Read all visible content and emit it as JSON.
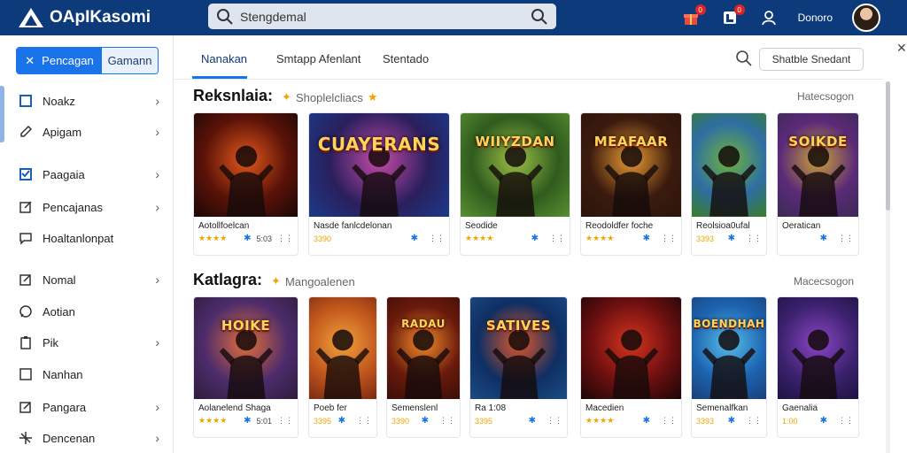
{
  "brand": {
    "name": "OApIKasomi"
  },
  "search": {
    "value": "Stengdemal"
  },
  "topbar": {
    "user_label": "Donoro",
    "badge_a": "0",
    "badge_b": "0"
  },
  "sidebar": {
    "toggle_primary": "Pencagan",
    "toggle_secondary": "Gamann",
    "items": [
      {
        "label": "Noakz",
        "icon": "square-icon"
      },
      {
        "label": "Apigam",
        "icon": "pencil-icon"
      },
      {
        "label": "Paagaia",
        "icon": "checkbox-icon"
      },
      {
        "label": "Pencajanas",
        "icon": "edit-icon"
      },
      {
        "label": "Hoaltanlonpat",
        "icon": "chat-icon"
      },
      {
        "label": "Nomal",
        "icon": "pencil-icon"
      },
      {
        "label": "Aotian",
        "icon": "message-icon"
      },
      {
        "label": "Pik",
        "icon": "clipboard-icon"
      },
      {
        "label": "Nanhan",
        "icon": "square-icon"
      },
      {
        "label": "Pangara",
        "icon": "edit-icon"
      },
      {
        "label": "Dencenan",
        "icon": "star-icon"
      }
    ]
  },
  "tabs": [
    {
      "label": "Nanakan"
    },
    {
      "label": "Smtapp Afenlant"
    },
    {
      "label": "Stentado"
    }
  ],
  "toolbar": {
    "button_label": "Shatble Snedant"
  },
  "section1": {
    "title": "Reksnlaia:",
    "subtitle": "Shoplelcliacs",
    "more": "Hatecsogon",
    "cards": [
      {
        "title_art": "",
        "name": "Aotollfoelcan",
        "stars": "★★★★",
        "price": "5:03",
        "colors": [
          "#5a1208",
          "#e2571b",
          "#1a0806"
        ]
      },
      {
        "title_art": "CUAYERANS",
        "name": "Nasde fanlcdelonan",
        "stars": "3390",
        "price": "",
        "colors": [
          "#2a1f5c",
          "#c64ba8",
          "#1b3a8a"
        ]
      },
      {
        "title_art": "WIIYZDAN",
        "name": "Seodide",
        "stars": "★★★★",
        "price": "",
        "colors": [
          "#2f5b1e",
          "#9bbf45",
          "#5a8f31"
        ]
      },
      {
        "title_art": "MEAFAAR",
        "name": "Reodoldfer foche",
        "stars": "★★★★",
        "price": "",
        "colors": [
          "#3c1b0e",
          "#e89a33",
          "#2b140b"
        ]
      },
      {
        "title_art": "",
        "name": "Reolsioa0ufal",
        "stars": "3393",
        "price": "",
        "colors": [
          "#2e6ea3",
          "#6fb23c",
          "#3b7d2a"
        ]
      },
      {
        "title_art": "SOIKDE",
        "name": "Oeratican",
        "stars": "",
        "price": "",
        "colors": [
          "#5b2a78",
          "#c9a13a",
          "#3a2a55"
        ]
      }
    ]
  },
  "section2": {
    "title": "Katlagra:",
    "subtitle": "Mangoalenen",
    "more": "Macecsogon",
    "cards": [
      {
        "title_art": "HOIKE",
        "name": "Aolanelend Shaga",
        "stars": "★★★★",
        "price": "5:01",
        "colors": [
          "#4d2c6b",
          "#e36d3a",
          "#2d1d3d"
        ]
      },
      {
        "title_art": "",
        "name": "Poeb fer",
        "stars": "3395",
        "price": "",
        "colors": [
          "#c2571c",
          "#f1a13c",
          "#7c2a10"
        ]
      },
      {
        "title_art": "RADAU",
        "name": "Semenslenl",
        "stars": "3390",
        "price": "",
        "colors": [
          "#6a1a0c",
          "#f08a2a",
          "#3a0e07"
        ]
      },
      {
        "title_art": "SATIVES",
        "name": "Ra 1:08",
        "stars": "3395",
        "price": "",
        "colors": [
          "#0f2f63",
          "#e0572a",
          "#1b4c86"
        ]
      },
      {
        "title_art": "",
        "name": "Macedien",
        "stars": "★★★★",
        "price": "",
        "colors": [
          "#6c0f10",
          "#d6331e",
          "#1a0606"
        ]
      },
      {
        "title_art": "BOENDHAH",
        "name": "Semenalfkan",
        "stars": "3393",
        "price": "",
        "colors": [
          "#1d64b0",
          "#56bde9",
          "#18407a"
        ]
      },
      {
        "title_art": "",
        "name": "Gaenalia",
        "stars": "1:00",
        "price": "",
        "colors": [
          "#3d2270",
          "#8b45c6",
          "#1c1240"
        ]
      }
    ]
  }
}
